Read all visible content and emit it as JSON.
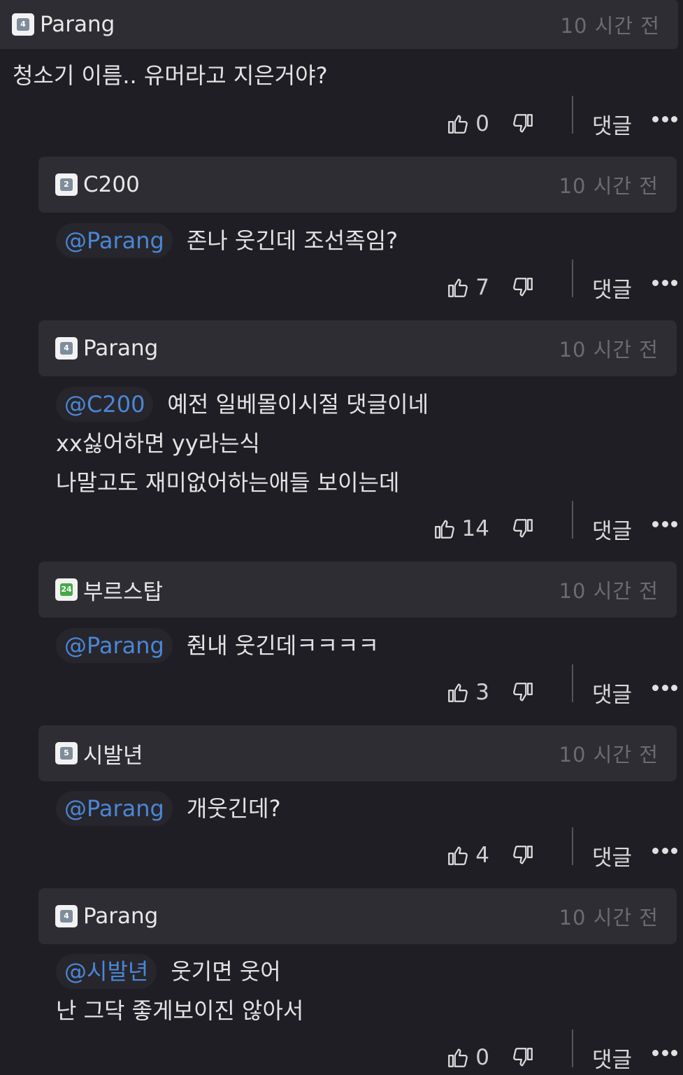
{
  "comments": [
    {
      "user": "Parang",
      "level": "4",
      "time": "10 시간 전",
      "mention": "",
      "lines": [
        "청소기 이름.. 유머라고 지은거야?"
      ],
      "likes": "0",
      "reply_label": "댓글"
    },
    {
      "user": "C200",
      "level": "2",
      "time": "10 시간 전",
      "mention": "@Parang",
      "lines": [
        "존나 웃긴데 조선족임?"
      ],
      "likes": "7",
      "reply_label": "댓글"
    },
    {
      "user": "Parang",
      "level": "4",
      "time": "10 시간 전",
      "mention": "@C200",
      "lines": [
        "예전 일베몰이시절 댓글이네",
        "xx싫어하면 yy라는식",
        "나말고도 재미없어하는애들 보이는데"
      ],
      "likes": "14",
      "reply_label": "댓글"
    },
    {
      "user": "부르스탑",
      "level": "24",
      "time": "10 시간 전",
      "mention": "@Parang",
      "lines": [
        "줜내 웃긴데ㅋㅋㅋㅋ"
      ],
      "likes": "3",
      "reply_label": "댓글"
    },
    {
      "user": "시발년",
      "level": "5",
      "time": "10 시간 전",
      "mention": "@Parang",
      "lines": [
        "개웃긴데?"
      ],
      "likes": "4",
      "reply_label": "댓글"
    },
    {
      "user": "Parang",
      "level": "4",
      "time": "10 시간 전",
      "mention": "@시발년",
      "lines": [
        "웃기면 웃어",
        "난 그닥 좋게보이진 않아서"
      ],
      "likes": "0",
      "reply_label": "댓글"
    }
  ],
  "icons": {
    "like": "thumbs-up-icon",
    "dislike": "thumbs-down-icon",
    "more": "more-dots-icon"
  },
  "colors": {
    "background": "#1f1e24",
    "header": "#2e2d33",
    "mention": "#4a87d6"
  }
}
